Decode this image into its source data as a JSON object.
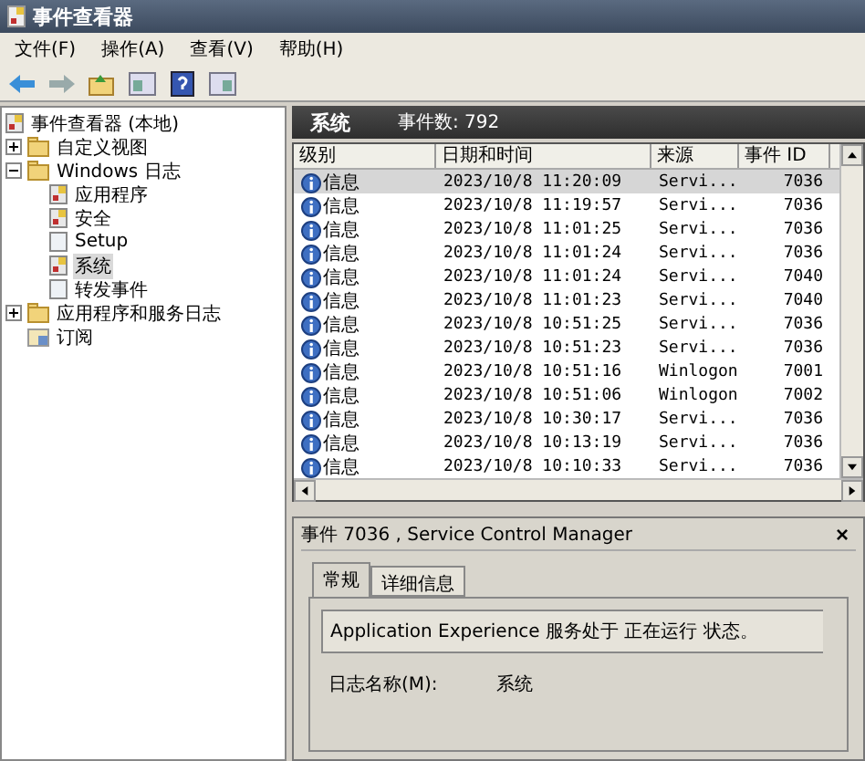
{
  "window": {
    "title": "事件查看器"
  },
  "menu": [
    "文件(F)",
    "操作(A)",
    "查看(V)",
    "帮助(H)"
  ],
  "tree": {
    "label": "事件查看器 (本地)",
    "children": [
      {
        "label": "自定义视图",
        "expanded": false,
        "kind": "folder"
      },
      {
        "label": "Windows 日志",
        "expanded": true,
        "kind": "folder",
        "children": [
          {
            "label": "应用程序",
            "kind": "log",
            "selected": false
          },
          {
            "label": "安全",
            "kind": "log",
            "selected": false
          },
          {
            "label": "Setup",
            "kind": "blank",
            "selected": false
          },
          {
            "label": "系统",
            "kind": "log",
            "selected": true
          },
          {
            "label": "转发事件",
            "kind": "blank",
            "selected": false
          }
        ]
      },
      {
        "label": "应用程序和服务日志",
        "expanded": false,
        "kind": "folder"
      },
      {
        "label": "订阅",
        "kind": "sub"
      }
    ]
  },
  "log_header": {
    "name": "系统",
    "count": "事件数: 792"
  },
  "table": {
    "columns": [
      "级别",
      "日期和时间",
      "来源",
      "事件 ID"
    ],
    "rows": [
      {
        "level": "信息",
        "time": "2023/10/8 11:20:09",
        "source": "Servi...",
        "id": "7036",
        "selected": true
      },
      {
        "level": "信息",
        "time": "2023/10/8 11:19:57",
        "source": "Servi...",
        "id": "7036",
        "selected": false
      },
      {
        "level": "信息",
        "time": "2023/10/8 11:01:25",
        "source": "Servi...",
        "id": "7036",
        "selected": false
      },
      {
        "level": "信息",
        "time": "2023/10/8 11:01:24",
        "source": "Servi...",
        "id": "7036",
        "selected": false
      },
      {
        "level": "信息",
        "time": "2023/10/8 11:01:24",
        "source": "Servi...",
        "id": "7040",
        "selected": false
      },
      {
        "level": "信息",
        "time": "2023/10/8 11:01:23",
        "source": "Servi...",
        "id": "7040",
        "selected": false
      },
      {
        "level": "信息",
        "time": "2023/10/8 10:51:25",
        "source": "Servi...",
        "id": "7036",
        "selected": false
      },
      {
        "level": "信息",
        "time": "2023/10/8 10:51:23",
        "source": "Servi...",
        "id": "7036",
        "selected": false
      },
      {
        "level": "信息",
        "time": "2023/10/8 10:51:16",
        "source": "Winlogon",
        "id": "7001",
        "selected": false
      },
      {
        "level": "信息",
        "time": "2023/10/8 10:51:06",
        "source": "Winlogon",
        "id": "7002",
        "selected": false
      },
      {
        "level": "信息",
        "time": "2023/10/8 10:30:17",
        "source": "Servi...",
        "id": "7036",
        "selected": false
      },
      {
        "level": "信息",
        "time": "2023/10/8 10:13:19",
        "source": "Servi...",
        "id": "7036",
        "selected": false
      },
      {
        "level": "信息",
        "time": "2023/10/8 10:10:33",
        "source": "Servi...",
        "id": "7036",
        "selected": false
      }
    ]
  },
  "detail": {
    "title": "事件 7036 , Service Control Manager",
    "close": "×",
    "tabs": [
      {
        "label": "常规",
        "selected": true
      },
      {
        "label": "详细信息",
        "selected": false
      }
    ],
    "message": "Application Experience 服务处于 正在运行 状态。",
    "field_label": "日志名称(M):",
    "field_value": "系统"
  }
}
